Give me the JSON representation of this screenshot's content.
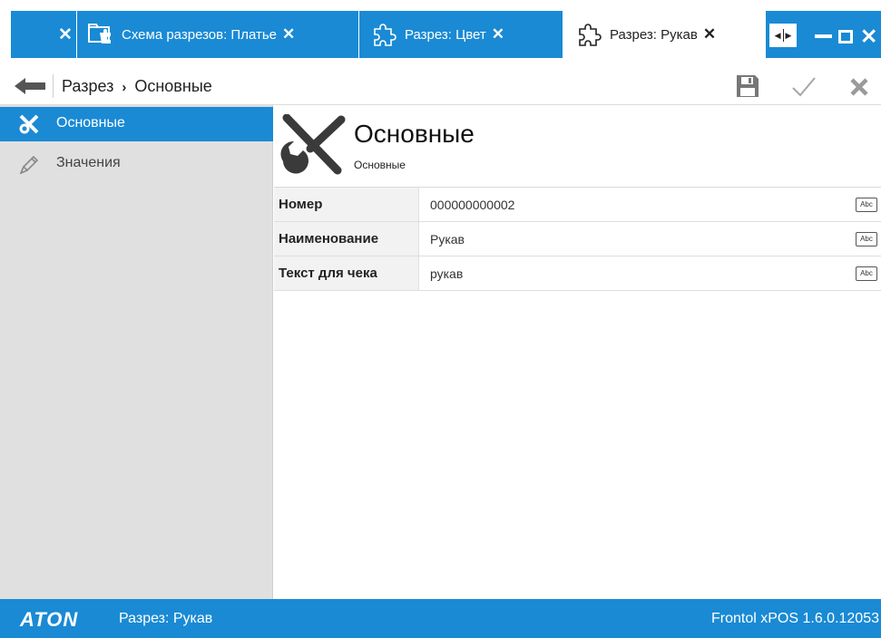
{
  "tabs": [
    {
      "label": "",
      "close": "✕"
    },
    {
      "label": "Схема разрезов: Платье",
      "close": "✕"
    },
    {
      "label": "Разрез: Цвет",
      "close": "✕"
    },
    {
      "label": "Разрез: Рукав",
      "close": "✕"
    }
  ],
  "window_controls": {
    "scroll_left": "◀",
    "scroll_right": "▶",
    "close": "✕"
  },
  "breadcrumb": {
    "root": "Разрез",
    "separator": "›",
    "current": "Основные"
  },
  "sidebar": {
    "items": [
      {
        "label": "Основные",
        "icon": "tools-icon",
        "selected": true
      },
      {
        "label": "Значения",
        "icon": "pen-icon",
        "selected": false
      }
    ]
  },
  "section": {
    "title": "Основные",
    "subtitle": "Основные"
  },
  "properties": [
    {
      "name": "Номер",
      "value": "000000000002",
      "type_badge": "Abc"
    },
    {
      "name": "Наименование",
      "value": "Рукав",
      "type_badge": "Abc"
    },
    {
      "name": "Текст для чека",
      "value": "рукав",
      "type_badge": "Abc"
    }
  ],
  "statusbar": {
    "logo": "ATON",
    "status": "Разрез: Рукав",
    "version": "Frontol xPOS 1.6.0.12053"
  },
  "colors": {
    "accent": "#1a8ad4",
    "sidebar_bg": "#e0e0e0",
    "white": "#ffffff"
  }
}
